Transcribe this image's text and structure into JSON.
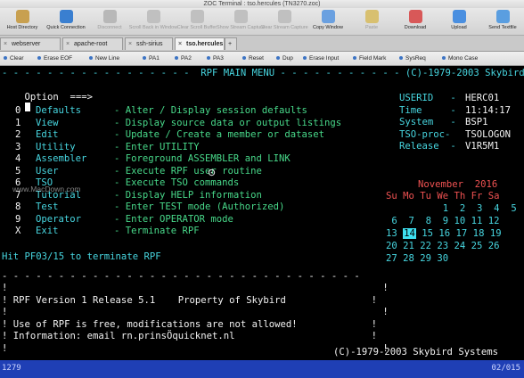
{
  "window": {
    "title": "ZOC Terminal : tso.hercules (TN3270.zoc)"
  },
  "toolbar": [
    {
      "label": "Host Directory",
      "icon": "book-icon",
      "color": "#c8a050",
      "enabled": true
    },
    {
      "label": "Quick Connection",
      "icon": "lightning-icon",
      "color": "#3a7fd0",
      "enabled": true
    },
    {
      "label": "Disconnect",
      "icon": "plug-icon",
      "color": "#b8b8b8",
      "enabled": false
    },
    {
      "label": "Scroll Back in Window",
      "icon": "scroll-icon",
      "color": "#c0c0c0",
      "enabled": false
    },
    {
      "label": "Clear Scroll Buffer",
      "icon": "eraser-icon",
      "color": "#c0c0c0",
      "enabled": false
    },
    {
      "label": "Show Stream Capture",
      "icon": "capture-icon",
      "color": "#c0c0c0",
      "enabled": false
    },
    {
      "label": "Clear Stream Capture",
      "icon": "capture-clear-icon",
      "color": "#c0c0c0",
      "enabled": false
    },
    {
      "label": "Copy Window",
      "icon": "copy-icon",
      "color": "#6aa0e0",
      "enabled": true
    },
    {
      "label": "Paste",
      "icon": "paste-icon",
      "color": "#d8c070",
      "enabled": false
    },
    {
      "label": "Download",
      "icon": "download-icon",
      "color": "#d85858",
      "enabled": true
    },
    {
      "label": "Upload",
      "icon": "upload-icon",
      "color": "#4a8fe0",
      "enabled": true
    },
    {
      "label": "Send Textfile",
      "icon": "textfile-icon",
      "color": "#5a9ee0",
      "enabled": true
    }
  ],
  "tabs": [
    {
      "label": "webserver",
      "active": false
    },
    {
      "label": "apache-root",
      "active": false
    },
    {
      "label": "ssh-sirius",
      "active": false
    },
    {
      "label": "tso.hercules",
      "active": true
    },
    {
      "label": "+",
      "active": false
    }
  ],
  "keybar": [
    "Clear",
    "Erase EOF",
    "New Line",
    "PA1",
    "PA2",
    "PA3",
    "Reset",
    "Dup",
    "Erase Input",
    "Field Mark",
    "SysReq",
    "Mono Case"
  ],
  "screen": {
    "header": "- - - - - - - - - - - - - - - - -  RPF MAIN MENU - - - - - - - - - - - (C)-1979-2003 Skybird",
    "option_label": "Option  ===>",
    "menu": [
      {
        "key": "0",
        "name": "Defaults",
        "desc": "- Alter / Display session defaults"
      },
      {
        "key": "1",
        "name": "View",
        "desc": "- Display source data or output listings"
      },
      {
        "key": "2",
        "name": "Edit",
        "desc": "- Update / Create a member or dataset"
      },
      {
        "key": "3",
        "name": "Utility",
        "desc": "- Enter UTILITY"
      },
      {
        "key": "4",
        "name": "Assembler",
        "desc": "- Foreground ASSEMBLER and LINK"
      },
      {
        "key": "5",
        "name": "User",
        "desc": "- Execute RPF user routine"
      },
      {
        "key": "6",
        "name": "TSO",
        "desc": "- Execute TSO commands"
      },
      {
        "key": "7",
        "name": "Tutorial",
        "desc": "- Display HELP information"
      },
      {
        "key": "8",
        "name": "Test",
        "desc": "- Enter TEST mode (Authorized)"
      },
      {
        "key": "9",
        "name": "Operator",
        "desc": "- Enter OPERATOR mode"
      },
      {
        "key": "X",
        "name": "Exit",
        "desc": "- Terminate RPF"
      }
    ],
    "info": [
      {
        "label": "USERID   -",
        "value": "HERC01"
      },
      {
        "label": "Time     -",
        "value": "11:14:17"
      },
      {
        "label": "System   -",
        "value": "BSP1"
      },
      {
        "label": "TSO-proc-",
        "value": "TSOLOGON"
      },
      {
        "label": "Release  -",
        "value": "V1R5M1"
      }
    ],
    "calendar": {
      "month": "November  2016",
      "weekdays": "Su Mo Tu We Th Fr Sa",
      "weeks": [
        "          1  2  3  4  5",
        " 6  7  8  9 10 11 12",
        "13 14 15 16 17 18 19",
        "20 21 22 23 24 25 26",
        "27 28 29 30"
      ],
      "today": "14"
    },
    "hint": "Hit PF03/15 to terminate RPF",
    "box_top": "- - - - - - - - - - - - - - - - - - - - - - - - - - - - - - - -",
    "box_lines": [
      "!                                                                  !",
      "! RPF Version 1 Release 5.1    Property of Skybird               !",
      "!                                                                  !",
      "! Use of RPF is free, modifications are not allowed!             !",
      "! Information: email rn.prinsÖquicknet.nl                        !",
      "!                                                                  !"
    ],
    "footer": "(C)-1979-2003 Skybird Systems",
    "watermark": "www.MacDown.com"
  },
  "status": {
    "left": "1279",
    "right": "02/015"
  }
}
